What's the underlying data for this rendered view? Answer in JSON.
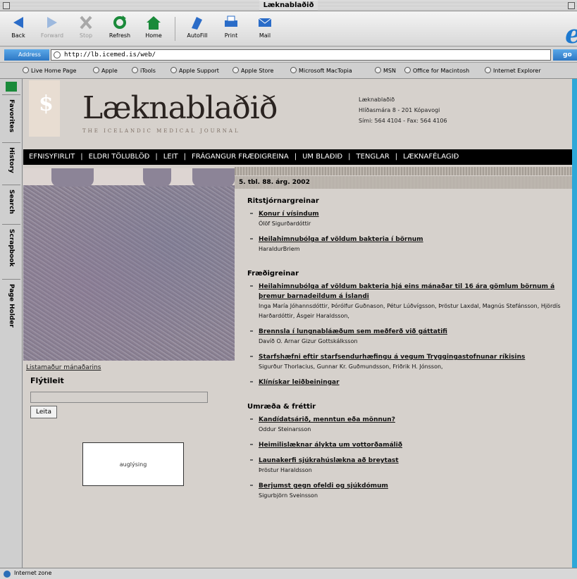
{
  "window": {
    "title": "Læknablaðið"
  },
  "toolbar": {
    "buttons": [
      {
        "label": "Back"
      },
      {
        "label": "Forward"
      },
      {
        "label": "Stop"
      },
      {
        "label": "Refresh"
      },
      {
        "label": "Home"
      },
      {
        "label": "AutoFill"
      },
      {
        "label": "Print"
      },
      {
        "label": "Mail"
      }
    ]
  },
  "address": {
    "label": "Address",
    "url": "http://lb.icemed.is/web/",
    "go": "go"
  },
  "favorites": [
    "Live Home Page",
    "Apple",
    "iTools",
    "Apple Support",
    "Apple Store",
    "Microsoft MacTopia",
    "MSN",
    "Office for Macintosh",
    "Internet Explorer"
  ],
  "side_tabs": [
    "Favorites",
    "History",
    "Search",
    "Scrapbook",
    "Page Holder"
  ],
  "status": {
    "text": "Internet zone"
  },
  "site": {
    "logo_title": "Læknablaðið",
    "logo_sub": "THE ICELANDIC MEDICAL JOURNAL",
    "contact": [
      "Læknablaðið",
      "Hlíðasmára 8 - 201 Kópavogi",
      "Sími: 564 4104 - Fax: 564 4106"
    ],
    "nav": [
      "EFNISYFIRLIT",
      "ELDRI TÖLUBLÖÐ",
      "LEIT",
      "FRÁGANGUR FRÆÐIGREINA",
      "UM BLAÐIÐ",
      "TENGLAR",
      "LÆKNAFÉLAGIÐ"
    ],
    "art_caption": "Listamaður mánaðarins",
    "search_title": "Flýtileit",
    "search_button": "Leita",
    "ad_text": "auglýsing",
    "issue": "5. tbl. 88. árg. 2002",
    "sections": [
      {
        "heading": "Ritstjórnargreinar",
        "items": [
          {
            "title": "Konur í vísindum",
            "authors": "Ólöf Sigurðardóttir"
          },
          {
            "title": "Heilahimnubólga af völdum bakteria í börnum",
            "authors": "HaraldurBriem"
          }
        ]
      },
      {
        "heading": "Fræðigreinar",
        "items": [
          {
            "title": "Heilahimnubólga af völdum bakteria hjá eins mánaðar til 16 ára gömlum börnum á þremur barnadeildum á Íslandi",
            "authors": "Inga María Jóhannsdóttir, Þórólfur Guðnason, Pétur Lúðvígsson, Þröstur Laxdal, Magnús Stefánsson, Hjördís Harðardóttir, Ásgeir Haraldsson,"
          },
          {
            "title": "Brennsla í lungnabláæðum sem meðferð við gáttatifi",
            "authors": "Davíð O. Arnar Gizur Gottskálksson"
          },
          {
            "title": "Starfshæfni eftir starfsendurhæfingu á vegum Tryggingastofnunar ríkisins",
            "authors": "Sigurður Thorlacius, Gunnar Kr. Guðmundsson, Friðrik H. Jónsson,"
          },
          {
            "title": "Klínískar leiðbeiningar",
            "authors": ""
          }
        ]
      },
      {
        "heading": "Umræða & fréttir",
        "items": [
          {
            "title": "Kandídatsárið, menntun eða mönnun?",
            "authors": "Oddur Steinarsson"
          },
          {
            "title": "Heimilislæknar álykta um vottorðamálið",
            "authors": ""
          },
          {
            "title": "Launakerfi sjúkrahúslækna að breytast",
            "authors": "Þröstur Haraldsson"
          },
          {
            "title": "Berjumst gegn ofeldi og sjúkdómum",
            "authors": "Sigurbjörn Sveinsson"
          }
        ]
      }
    ]
  }
}
